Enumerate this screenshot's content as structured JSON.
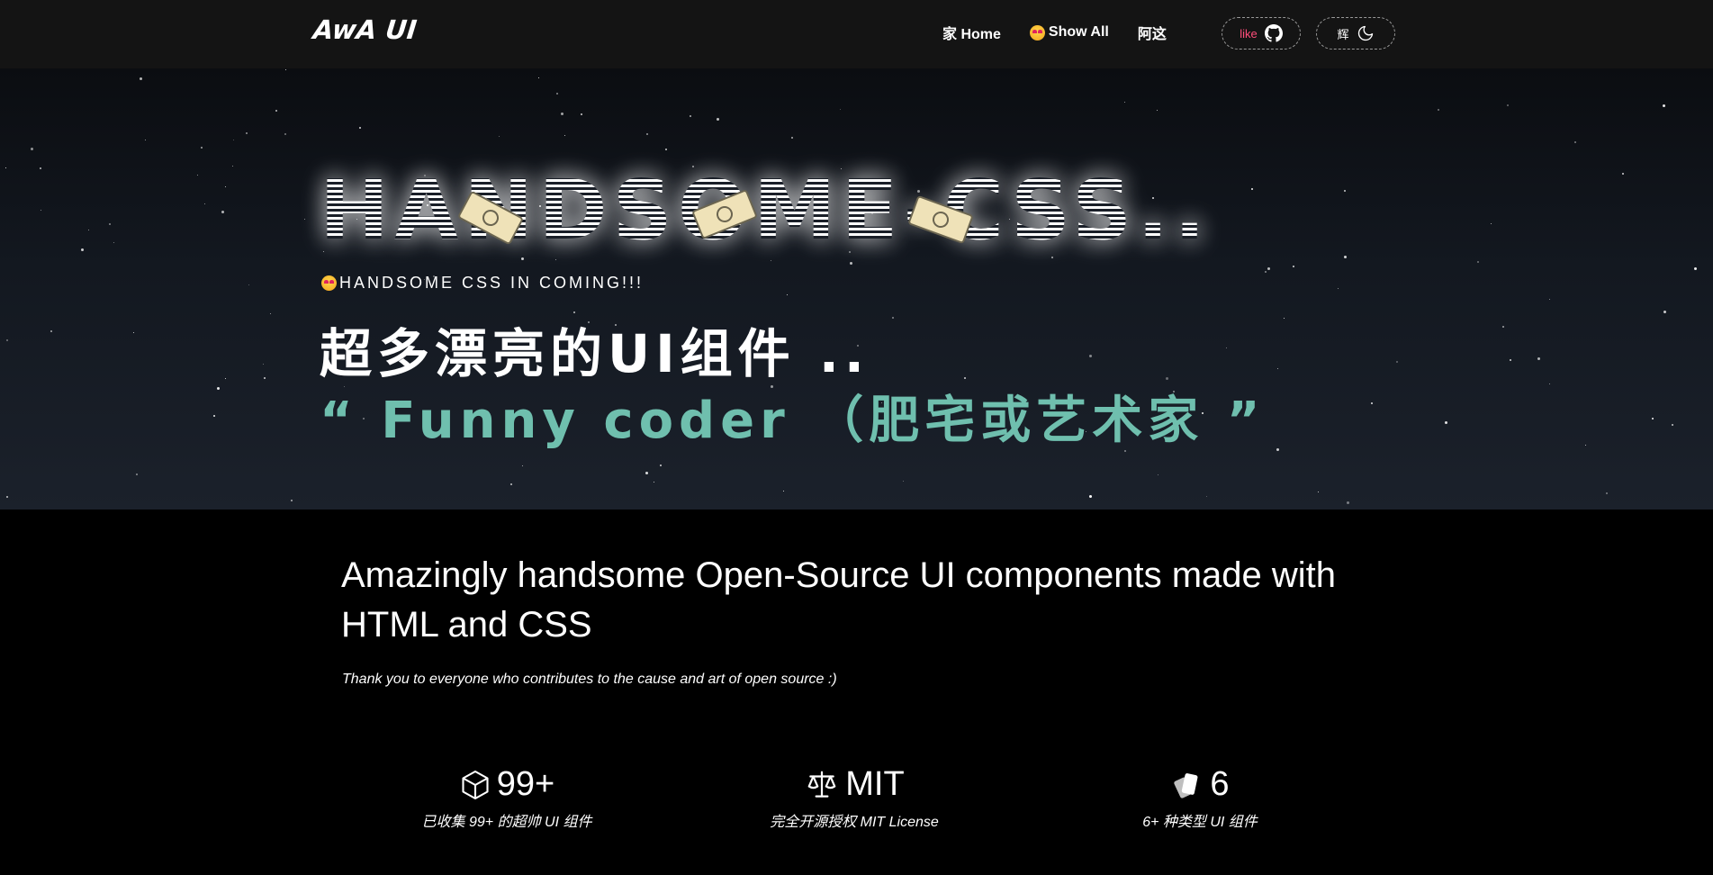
{
  "navbar": {
    "logo": "AwA UI",
    "links": [
      {
        "label": "家 Home"
      },
      {
        "label": "Show All"
      },
      {
        "label": "阿这"
      }
    ],
    "like_label": "like",
    "theme_label": "辉"
  },
  "hero": {
    "title": "HANDSOME-CSS..",
    "subtag": "HANDSOME CSS IN COMING!!!",
    "cn_title": "超多漂亮的UI组件 ..",
    "quote": "“ Funny coder （肥宅或艺术家 ”"
  },
  "main": {
    "heading": "Amazingly handsome Open-Source UI components made with HTML and CSS",
    "subheading": "Thank you to everyone who contributes to the cause and art of open source :)"
  },
  "stats": [
    {
      "icon": "cube-icon",
      "value": "99+",
      "label": "已收集 99+ 的超帅 UI 组件"
    },
    {
      "icon": "scale-icon",
      "value": "MIT",
      "label": "完全开源授权 MIT License"
    },
    {
      "icon": "cards-icon",
      "value": "6",
      "label": "6+ 种类型 UI 组件"
    }
  ],
  "colors": {
    "accent_teal": "#6fbfae",
    "like_pink": "#ff4d7a",
    "navbar_bg": "#141414"
  }
}
